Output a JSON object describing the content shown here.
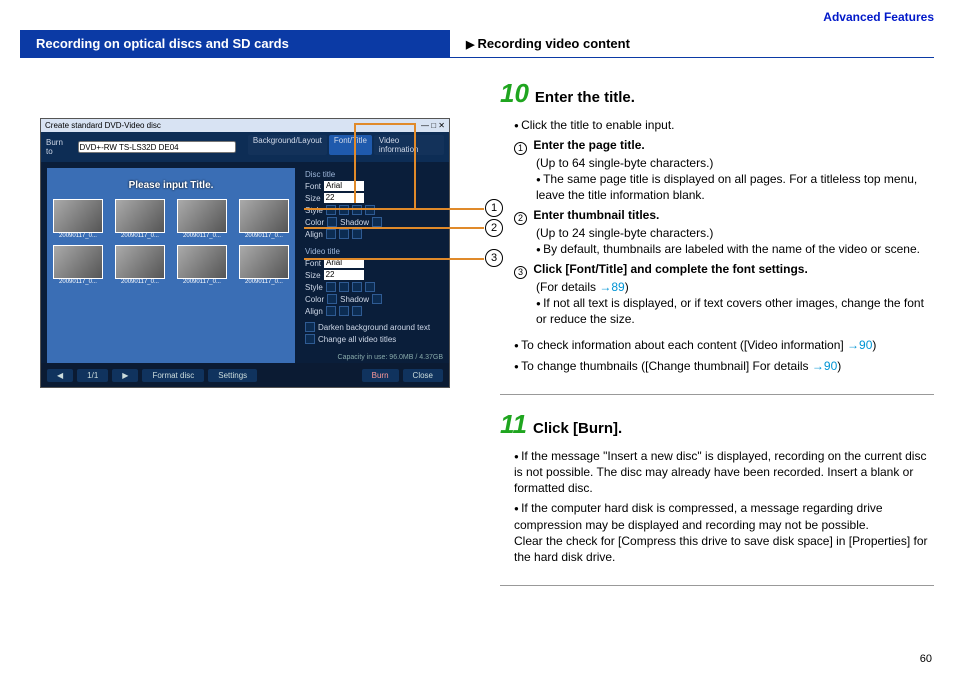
{
  "header": {
    "category": "Advanced Features",
    "left": "Recording on optical discs and SD cards",
    "right": "Recording video content"
  },
  "screenshot": {
    "window_title": "Create standard DVD-Video disc",
    "burn_to_label": "Burn to",
    "burn_to_value": "DVD+-RW TS-LS32D DE04",
    "tabs": {
      "bg": "Background/Layout",
      "font": "Font/Title",
      "info": "Video information"
    },
    "preview_title": "Please input Title.",
    "thumb_caption": "20090117_0...",
    "panel": {
      "disc_title": "Disc title",
      "video_title": "Video title",
      "font_label": "Font",
      "font_value": "Arial",
      "size_label": "Size",
      "size_value": "22",
      "style_label": "Style",
      "color_label": "Color",
      "shadow_label": "Shadow",
      "align_label": "Align",
      "darken_bg": "Darken background around text",
      "change_all": "Change all video titles"
    },
    "bottom": {
      "nav": "1/1",
      "format_disc": "Format disc",
      "settings": "Settings",
      "capacity": "Capacity in use: 96.0MB / 4.37GB",
      "burn": "Burn",
      "close": "Close"
    }
  },
  "callouts": {
    "c1": "1",
    "c2": "2",
    "c3": "3"
  },
  "step10": {
    "num": "10",
    "title": "Enter the title.",
    "b1": "Click the title to enable input.",
    "s1_label": "Enter the page title.",
    "s1_note": "(Up to 64 single-byte characters.)",
    "s1_b": "The same page title is displayed on all pages. For a titleless top menu, leave the title information blank.",
    "s2_label": "Enter thumbnail titles.",
    "s2_note": "(Up to 24 single-byte characters.)",
    "s2_b": "By default, thumbnails are labeled with the name of the video or scene.",
    "s3_label": "Click [Font/Title] and complete the font settings.",
    "s3_note_a": "(For details ",
    "s3_note_link": "→89",
    "s3_note_b": ")",
    "s3_b": "If not all text is displayed, or if text covers other images, change the font or reduce the size.",
    "tail1_a": "To check information about each content ([Video information] ",
    "tail1_link": "→90",
    "tail1_b": ")",
    "tail2_a": "To change thumbnails ([Change thumbnail] For details ",
    "tail2_link": "→90",
    "tail2_b": ")"
  },
  "step11": {
    "num": "11",
    "title": "Click [Burn].",
    "b1": "If the message \"Insert a new disc\" is displayed, recording on the current disc is not possible. The disc may already have been recorded. Insert a blank or formatted disc.",
    "b2": "If the computer hard disk is compressed, a message regarding drive compression may be displayed and recording may not be possible.",
    "b2_sub": "Clear the check for [Compress this drive to save disk space] in [Properties] for the hard disk drive."
  },
  "page_number": "60"
}
